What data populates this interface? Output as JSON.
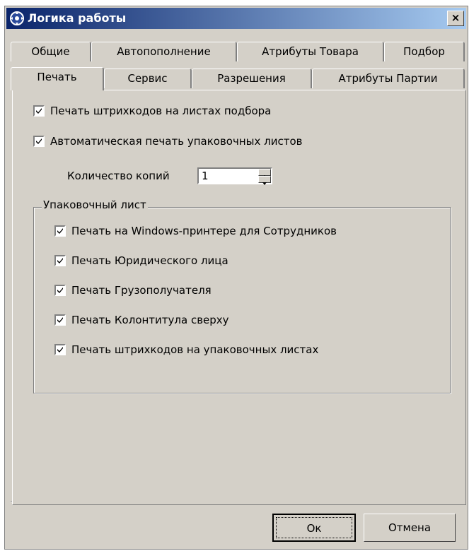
{
  "window": {
    "title": "Логика работы",
    "close_label": "×"
  },
  "tabs": {
    "row_back": [
      {
        "label": "Общие"
      },
      {
        "label": "Автопополнение"
      },
      {
        "label": "Атрибуты Товара"
      },
      {
        "label": "Подбор"
      }
    ],
    "row_front": [
      {
        "label": "Печать",
        "active": true
      },
      {
        "label": "Сервис"
      },
      {
        "label": "Разрешения"
      },
      {
        "label": "Атрибуты Партии"
      }
    ]
  },
  "print_tab": {
    "barcodes_on_pick_sheets": {
      "label": "Печать штрихкодов на листах подбора",
      "checked": true
    },
    "auto_print_packing_sheets": {
      "label": "Автоматическая печать упаковочных листов",
      "checked": true
    },
    "copies": {
      "label": "Количество копий",
      "value": "1"
    },
    "packing_sheet_group": {
      "title": "Упаковочный лист",
      "options": [
        {
          "label": "Печать на Windows-принтере для Сотрудников",
          "checked": true
        },
        {
          "label": "Печать Юридического лица",
          "checked": true
        },
        {
          "label": "Печать Грузополучателя",
          "checked": true
        },
        {
          "label": "Печать Колонтитула сверху",
          "checked": true
        },
        {
          "label": "Печать штрихкодов на упаковочных листах",
          "checked": true
        }
      ]
    }
  },
  "buttons": {
    "ok_label": "Ок",
    "cancel_label": "Отмена"
  },
  "colors": {
    "titlebar_start": "#0a246a",
    "titlebar_end": "#a6caf0",
    "face": "#d4d0c8"
  },
  "icons": {
    "app": "gear-refresh-icon",
    "check": "checkmark-icon",
    "spin_up": "triangle-up-icon",
    "spin_down": "triangle-down-icon"
  }
}
